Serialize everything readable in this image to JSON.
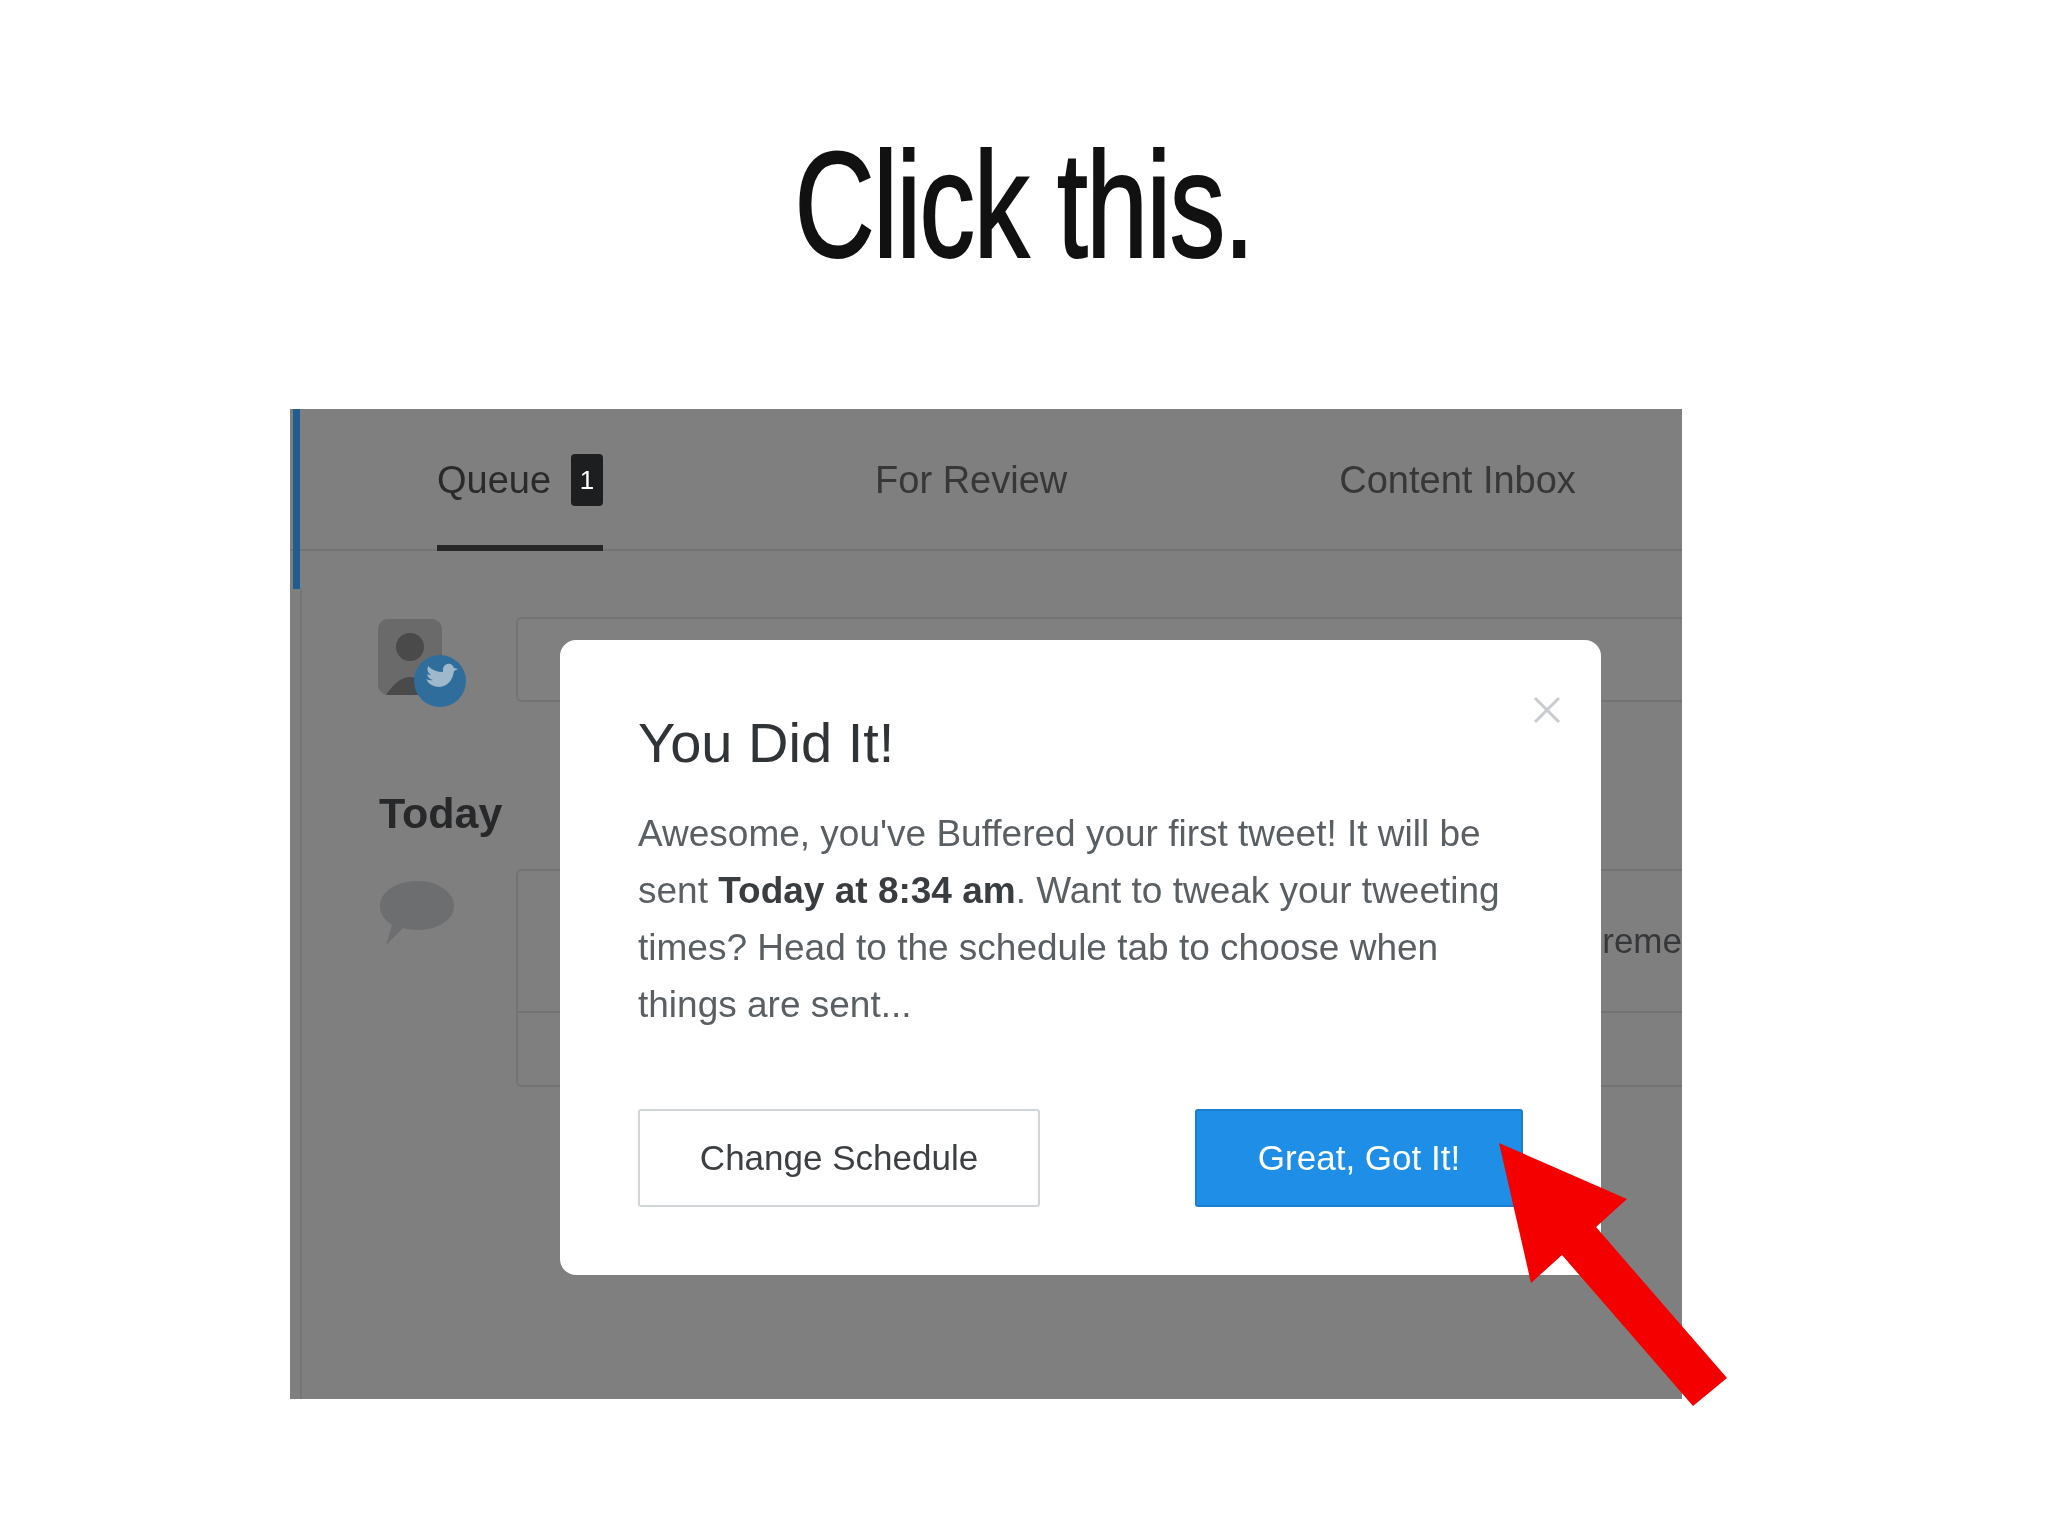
{
  "heading": "Click this.",
  "tabs": [
    {
      "label": "Queue",
      "badge": "1",
      "selected": true
    },
    {
      "label": "For Review",
      "selected": false
    },
    {
      "label": "Content Inbox",
      "selected": false
    }
  ],
  "day_heading": "Today",
  "post_card": {
    "text": "reme"
  },
  "dialog": {
    "title": "You Did It!",
    "message": "Awesome, you've Buffered your first tweet! It will be sent **Today at 8:34 am**. Want to tweak your tweeting times? Head to the schedule tab to choose when things are sent...",
    "buttons": [
      {
        "label": "Change Schedule",
        "kind": "secondary"
      },
      {
        "label": "Great, Got It!",
        "kind": "primary"
      }
    ]
  }
}
